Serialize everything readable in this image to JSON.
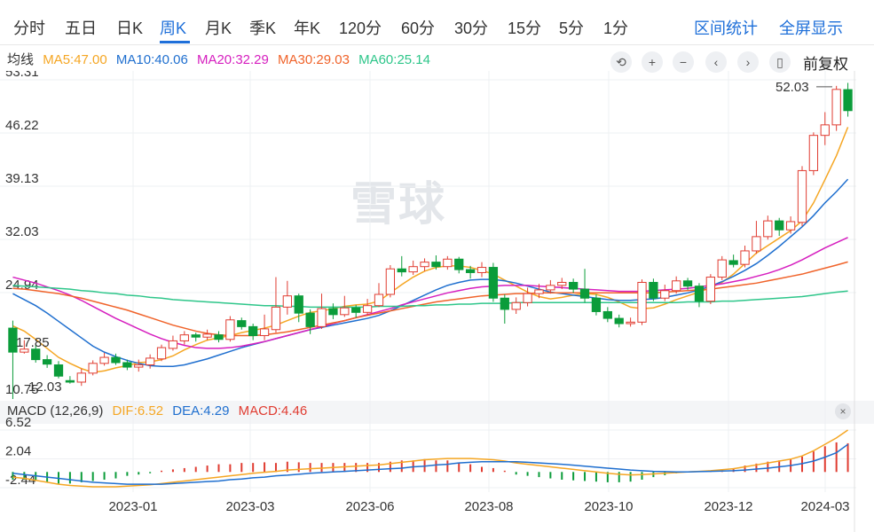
{
  "tabs": [
    "分时",
    "五日",
    "日K",
    "周K",
    "月K",
    "季K",
    "年K",
    "120分",
    "60分",
    "30分",
    "15分",
    "5分",
    "1分"
  ],
  "active_tab": "周K",
  "tools": {
    "interval_stats": "区间统计",
    "fullscreen": "全屏显示"
  },
  "ma": {
    "label": "均线",
    "items": [
      {
        "text": "MA5:47.00",
        "color": "#f5a623"
      },
      {
        "text": "MA10:40.06",
        "color": "#1f6fcf"
      },
      {
        "text": "MA20:32.29",
        "color": "#d61fbf"
      },
      {
        "text": "MA30:29.03",
        "color": "#f0632a"
      },
      {
        "text": "MA60:25.14",
        "color": "#2ec68a"
      }
    ]
  },
  "controls": {
    "icons": [
      "undo-icon",
      "zoom-in-icon",
      "zoom-out-icon",
      "left-arrow-icon",
      "right-arrow-icon",
      "bar-style-icon"
    ],
    "glyphs": [
      "⟲",
      "+",
      "−",
      "‹",
      "›",
      "▯"
    ],
    "adjust": "前复权"
  },
  "macd": {
    "label": "MACD (12,26,9)",
    "dif": "DIF:6.52",
    "dea": "DEA:4.29",
    "macd": "MACD:4.46",
    "dif_color": "#f5a623",
    "dea_color": "#1f6fcf",
    "macd_color": "#e03c31"
  },
  "watermark": "雪球",
  "colors": {
    "up": "#e03c31",
    "down": "#0b9c3a"
  },
  "chart_data": {
    "type": "candlestick",
    "price_axis": {
      "ticks": [
        53.31,
        46.22,
        39.13,
        32.03,
        24.94
      ],
      "range": [
        10.75,
        53.31
      ]
    },
    "annotations": {
      "max_label": "52.03",
      "min_label": "12.03",
      "low_label": "10.75",
      "mid_label": "17.85"
    },
    "macd_axis": {
      "ticks": [
        6.52,
        2.04,
        -2.44
      ],
      "range": [
        -2.44,
        6.52
      ]
    },
    "x_labels": [
      "2023-01",
      "2023-03",
      "2023-06",
      "2023-08",
      "2023-10",
      "2023-12",
      "2024-03"
    ],
    "candles": [
      [
        20.2,
        17.0,
        21.2,
        10.75
      ],
      [
        17.0,
        17.4,
        18.6,
        16.8
      ],
      [
        17.4,
        16.0,
        17.9,
        15.6
      ],
      [
        16.0,
        15.4,
        16.6,
        14.9
      ],
      [
        15.3,
        13.8,
        15.8,
        13.5
      ],
      [
        13.2,
        13.0,
        13.8,
        12.8
      ],
      [
        13.0,
        14.2,
        14.8,
        12.5
      ],
      [
        14.2,
        15.5,
        15.9,
        13.9
      ],
      [
        15.5,
        16.3,
        16.9,
        15.2
      ],
      [
        16.3,
        15.6,
        16.8,
        15.3
      ],
      [
        15.6,
        15.0,
        16.0,
        14.6
      ],
      [
        15.0,
        15.3,
        16.0,
        14.4
      ],
      [
        15.3,
        16.2,
        16.7,
        14.8
      ],
      [
        16.1,
        17.6,
        18.0,
        15.8
      ],
      [
        17.5,
        18.5,
        19.2,
        17.2
      ],
      [
        18.5,
        19.3,
        19.8,
        18.0
      ],
      [
        19.3,
        19.0,
        19.6,
        18.4
      ],
      [
        19.0,
        19.4,
        20.0,
        18.6
      ],
      [
        19.3,
        18.7,
        19.8,
        18.3
      ],
      [
        18.7,
        21.3,
        21.8,
        18.4
      ],
      [
        21.2,
        20.4,
        21.6,
        20.0
      ],
      [
        20.4,
        19.2,
        20.8,
        18.6
      ],
      [
        19.2,
        20.1,
        22.0,
        18.6
      ],
      [
        20.0,
        23.0,
        27.0,
        19.6
      ],
      [
        23.0,
        24.5,
        26.5,
        22.0
      ],
      [
        24.5,
        22.2,
        24.8,
        21.0
      ],
      [
        22.2,
        20.4,
        22.7,
        19.4
      ],
      [
        20.4,
        22.8,
        24.8,
        20.1
      ],
      [
        22.8,
        22.0,
        23.5,
        21.4
      ],
      [
        22.0,
        22.9,
        24.5,
        21.7
      ],
      [
        22.9,
        22.3,
        23.3,
        21.6
      ],
      [
        22.3,
        23.2,
        24.1,
        21.9
      ],
      [
        23.2,
        24.7,
        26.2,
        23.0
      ],
      [
        24.7,
        28.1,
        28.6,
        24.3
      ],
      [
        28.1,
        27.7,
        29.8,
        27.1
      ],
      [
        27.7,
        28.4,
        29.2,
        27.3
      ],
      [
        28.4,
        29.0,
        29.5,
        27.8
      ],
      [
        29.0,
        28.4,
        29.9,
        28.0
      ],
      [
        28.4,
        29.4,
        29.8,
        28.0
      ],
      [
        29.4,
        28.0,
        29.7,
        27.5
      ],
      [
        28.0,
        27.6,
        28.5,
        26.8
      ],
      [
        27.6,
        28.3,
        29.0,
        27.0
      ],
      [
        28.3,
        24.2,
        28.9,
        23.7
      ],
      [
        24.2,
        22.7,
        24.7,
        20.8
      ],
      [
        22.7,
        23.6,
        24.3,
        22.1
      ],
      [
        23.6,
        24.8,
        25.6,
        23.1
      ],
      [
        24.8,
        25.3,
        26.1,
        24.2
      ],
      [
        25.3,
        25.9,
        26.6,
        24.8
      ],
      [
        25.9,
        26.3,
        26.9,
        25.4
      ],
      [
        26.3,
        25.4,
        26.8,
        24.9
      ],
      [
        25.4,
        24.2,
        28.1,
        23.6
      ],
      [
        24.2,
        22.4,
        24.7,
        21.9
      ],
      [
        22.4,
        21.5,
        23.0,
        21.0
      ],
      [
        21.5,
        20.8,
        22.0,
        20.3
      ],
      [
        20.8,
        21.0,
        21.6,
        20.4
      ],
      [
        21.0,
        26.3,
        26.7,
        20.6
      ],
      [
        26.3,
        24.2,
        26.8,
        23.8
      ],
      [
        24.2,
        25.2,
        26.0,
        23.8
      ],
      [
        25.2,
        26.5,
        27.1,
        24.8
      ],
      [
        26.5,
        25.8,
        26.9,
        25.3
      ],
      [
        25.8,
        23.8,
        26.2,
        23.0
      ],
      [
        23.8,
        27.0,
        27.4,
        23.4
      ],
      [
        27.0,
        29.3,
        29.8,
        26.6
      ],
      [
        29.2,
        28.7,
        30.0,
        28.3
      ],
      [
        28.7,
        30.5,
        31.2,
        28.3
      ],
      [
        30.5,
        32.4,
        34.5,
        30.1
      ],
      [
        32.4,
        34.5,
        35.2,
        32.0
      ],
      [
        34.5,
        33.3,
        34.9,
        32.5
      ],
      [
        33.3,
        34.4,
        35.1,
        32.8
      ],
      [
        34.3,
        41.2,
        41.8,
        33.8
      ],
      [
        41.2,
        45.9,
        46.3,
        40.6
      ],
      [
        45.9,
        47.3,
        49.0,
        44.6
      ],
      [
        47.3,
        52.03,
        52.5,
        46.5
      ],
      [
        52.0,
        49.2,
        52.9,
        48.4
      ]
    ],
    "ma_series": {
      "MA5": [
        20.5,
        19.8,
        18.7,
        17.5,
        16.3,
        15.5,
        14.8,
        14.3,
        14.5,
        14.9,
        15.2,
        15.6,
        15.7,
        16.0,
        16.5,
        17.3,
        18.0,
        18.6,
        18.9,
        19.2,
        19.6,
        19.9,
        20.2,
        20.6,
        21.2,
        21.8,
        22.3,
        22.5,
        22.8,
        23.1,
        23.3,
        23.4,
        23.8,
        24.9,
        26.0,
        27.0,
        27.8,
        28.3,
        28.5,
        28.5,
        28.3,
        27.9,
        27.4,
        26.6,
        25.8,
        25.0,
        24.4,
        24.1,
        24.3,
        24.6,
        24.8,
        24.7,
        24.3,
        23.7,
        23.0,
        22.8,
        22.9,
        23.4,
        24.0,
        24.5,
        25.0,
        25.6,
        26.3,
        27.4,
        28.8,
        30.2,
        31.2,
        32.2,
        33.2,
        34.5,
        36.9,
        40.0,
        43.2,
        47.0
      ],
      "MA10": [
        24.8,
        24.0,
        23.2,
        22.2,
        21.1,
        20.0,
        18.9,
        17.8,
        17.0,
        16.4,
        15.9,
        15.5,
        15.2,
        15.1,
        15.1,
        15.3,
        15.7,
        16.1,
        16.6,
        17.1,
        17.6,
        18.0,
        18.4,
        18.8,
        19.2,
        19.6,
        20.0,
        20.3,
        20.6,
        20.9,
        21.2,
        21.5,
        21.9,
        22.5,
        23.2,
        23.9,
        24.6,
        25.3,
        25.9,
        26.3,
        26.6,
        26.7,
        26.7,
        26.5,
        26.2,
        25.8,
        25.4,
        25.0,
        24.8,
        24.6,
        24.4,
        24.2,
        24.0,
        23.9,
        23.9,
        24.0,
        24.1,
        24.3,
        24.6,
        24.9,
        25.3,
        25.8,
        26.4,
        27.1,
        27.9,
        28.8,
        29.9,
        31.1,
        32.4,
        33.7,
        35.2,
        36.9,
        38.4,
        40.06
      ],
      "MA20": [
        27.0,
        26.6,
        26.2,
        25.7,
        25.2,
        24.6,
        23.9,
        23.1,
        22.3,
        21.5,
        20.8,
        20.1,
        19.4,
        18.8,
        18.3,
        17.9,
        17.6,
        17.5,
        17.5,
        17.6,
        17.8,
        18.1,
        18.4,
        18.8,
        19.2,
        19.6,
        20.0,
        20.4,
        20.8,
        21.2,
        21.6,
        22.0,
        22.4,
        22.8,
        23.3,
        23.7,
        24.1,
        24.5,
        24.9,
        25.2,
        25.5,
        25.7,
        25.8,
        25.9,
        25.9,
        25.9,
        25.8,
        25.7,
        25.6,
        25.5,
        25.4,
        25.3,
        25.2,
        25.1,
        25.1,
        25.1,
        25.2,
        25.3,
        25.4,
        25.5,
        25.7,
        25.9,
        26.1,
        26.4,
        26.7,
        27.1,
        27.5,
        28.0,
        28.6,
        29.3,
        30.1,
        30.9,
        31.6,
        32.29
      ],
      "MA30": [
        25.5,
        25.4,
        25.2,
        25.0,
        24.8,
        24.5,
        24.2,
        23.8,
        23.4,
        23.0,
        22.6,
        22.1,
        21.6,
        21.1,
        20.6,
        20.2,
        19.8,
        19.5,
        19.3,
        19.2,
        19.2,
        19.2,
        19.3,
        19.5,
        19.7,
        20.0,
        20.3,
        20.6,
        20.9,
        21.2,
        21.6,
        21.9,
        22.2,
        22.5,
        22.8,
        23.1,
        23.4,
        23.7,
        23.9,
        24.1,
        24.3,
        24.5,
        24.6,
        24.7,
        24.8,
        24.8,
        24.9,
        24.9,
        24.9,
        24.9,
        24.9,
        24.9,
        24.9,
        24.9,
        24.9,
        24.9,
        24.9,
        25.0,
        25.1,
        25.2,
        25.3,
        25.4,
        25.6,
        25.8,
        26.0,
        26.2,
        26.5,
        26.8,
        27.1,
        27.4,
        27.8,
        28.2,
        28.6,
        29.03
      ],
      "MA60": [
        25.9,
        25.8,
        25.7,
        25.6,
        25.5,
        25.4,
        25.2,
        25.1,
        24.9,
        24.8,
        24.6,
        24.5,
        24.3,
        24.2,
        24.0,
        23.9,
        23.8,
        23.7,
        23.6,
        23.5,
        23.4,
        23.3,
        23.2,
        23.2,
        23.1,
        23.1,
        23.0,
        23.0,
        23.0,
        23.0,
        23.0,
        23.0,
        23.1,
        23.1,
        23.1,
        23.2,
        23.2,
        23.3,
        23.3,
        23.4,
        23.4,
        23.5,
        23.5,
        23.5,
        23.6,
        23.6,
        23.6,
        23.6,
        23.6,
        23.6,
        23.6,
        23.6,
        23.6,
        23.6,
        23.6,
        23.6,
        23.6,
        23.6,
        23.6,
        23.7,
        23.7,
        23.7,
        23.8,
        23.8,
        23.9,
        24.0,
        24.1,
        24.2,
        24.3,
        24.4,
        24.6,
        24.8,
        25.0,
        25.14
      ]
    },
    "macd_series": {
      "dif": [
        -0.8,
        -1.0,
        -1.3,
        -1.6,
        -1.9,
        -2.1,
        -2.2,
        -2.3,
        -2.3,
        -2.3,
        -2.2,
        -2.1,
        -2.0,
        -1.8,
        -1.6,
        -1.4,
        -1.2,
        -1.0,
        -0.8,
        -0.6,
        -0.4,
        -0.2,
        -0.05,
        0.1,
        0.3,
        0.4,
        0.5,
        0.6,
        0.7,
        0.8,
        0.9,
        1.0,
        1.1,
        1.3,
        1.5,
        1.7,
        1.9,
        2.0,
        2.1,
        2.1,
        2.1,
        2.0,
        1.9,
        1.7,
        1.4,
        1.2,
        1.0,
        0.8,
        0.6,
        0.4,
        0.2,
        0.0,
        -0.2,
        -0.35,
        -0.45,
        -0.4,
        -0.3,
        -0.2,
        -0.1,
        0.0,
        0.1,
        0.2,
        0.35,
        0.5,
        0.8,
        1.1,
        1.4,
        1.7,
        2.0,
        2.5,
        3.3,
        4.3,
        5.3,
        6.52
      ],
      "dea": [
        -0.2,
        -0.4,
        -0.6,
        -0.8,
        -1.0,
        -1.2,
        -1.4,
        -1.6,
        -1.7,
        -1.8,
        -1.9,
        -1.9,
        -1.9,
        -1.9,
        -1.8,
        -1.7,
        -1.6,
        -1.5,
        -1.4,
        -1.2,
        -1.1,
        -0.9,
        -0.8,
        -0.6,
        -0.5,
        -0.35,
        -0.2,
        -0.1,
        0.0,
        0.1,
        0.2,
        0.3,
        0.4,
        0.5,
        0.6,
        0.8,
        0.9,
        1.1,
        1.2,
        1.4,
        1.5,
        1.6,
        1.6,
        1.6,
        1.6,
        1.5,
        1.4,
        1.3,
        1.2,
        1.05,
        0.9,
        0.75,
        0.6,
        0.45,
        0.3,
        0.2,
        0.1,
        0.05,
        0.0,
        0.0,
        0.05,
        0.1,
        0.15,
        0.2,
        0.3,
        0.45,
        0.6,
        0.8,
        1.0,
        1.3,
        1.7,
        2.3,
        3.0,
        4.29
      ],
      "hist": [
        -1.2,
        -1.2,
        -1.4,
        -1.6,
        -1.8,
        -1.8,
        -1.6,
        -1.4,
        -1.2,
        -1.0,
        -0.6,
        -0.4,
        -0.2,
        0.2,
        0.4,
        0.6,
        0.8,
        1.0,
        1.2,
        1.2,
        1.4,
        1.4,
        1.5,
        1.4,
        1.6,
        1.5,
        1.4,
        1.4,
        1.4,
        1.4,
        1.4,
        1.4,
        1.4,
        1.6,
        1.8,
        1.8,
        2.0,
        1.8,
        1.8,
        1.4,
        1.2,
        0.8,
        0.6,
        0.2,
        -0.4,
        -0.6,
        -0.8,
        -1.0,
        -1.2,
        -1.3,
        -1.4,
        -1.5,
        -1.6,
        -1.6,
        -1.5,
        -1.2,
        -0.8,
        -0.5,
        -0.2,
        0.0,
        0.1,
        0.2,
        0.4,
        0.6,
        1.0,
        1.3,
        1.6,
        1.8,
        2.0,
        2.4,
        3.2,
        4.0,
        4.6,
        4.46
      ]
    }
  }
}
